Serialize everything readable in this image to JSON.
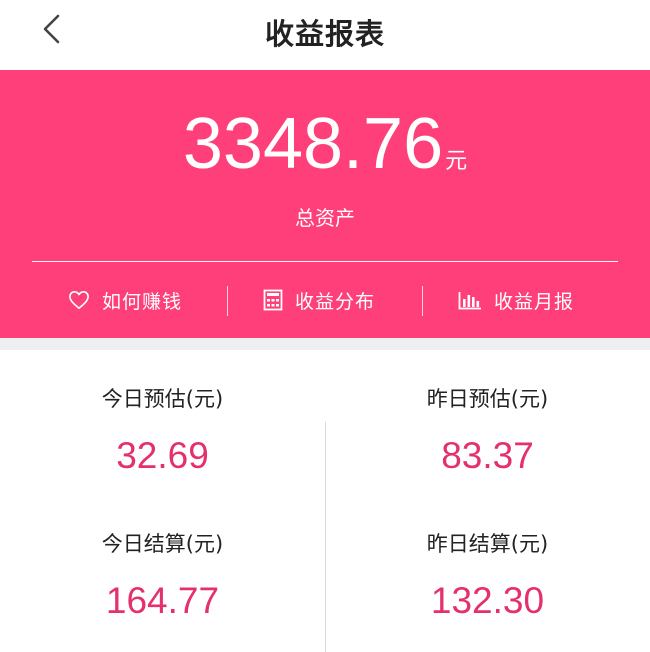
{
  "header": {
    "title": "收益报表"
  },
  "summary": {
    "amount": "3348.76",
    "unit": "元",
    "label": "总资产"
  },
  "actions": [
    {
      "label": "如何赚钱",
      "icon": "heart-icon"
    },
    {
      "label": "收益分布",
      "icon": "calculator-icon"
    },
    {
      "label": "收益月报",
      "icon": "bar-chart-icon"
    }
  ],
  "stats": [
    {
      "label": "今日预估(元)",
      "value": "32.69"
    },
    {
      "label": "昨日预估(元)",
      "value": "83.37"
    },
    {
      "label": "今日结算(元)",
      "value": "164.77"
    },
    {
      "label": "昨日结算(元)",
      "value": "132.30"
    }
  ],
  "colors": {
    "brand": "#fe3f79",
    "value_text": "#e4306b",
    "section_gap": "#efeff2"
  }
}
